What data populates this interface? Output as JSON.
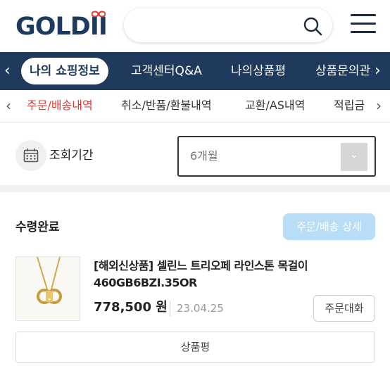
{
  "header": {
    "logo_text": "GOLDII",
    "search_placeholder": "",
    "colors": {
      "logo": "#1f3a5f",
      "logo_bow": "#e53935"
    }
  },
  "nav": {
    "items": [
      {
        "label": "나의 쇼핑정보",
        "active": true
      },
      {
        "label": "고객센터Q&A",
        "active": false
      },
      {
        "label": "나의상품평",
        "active": false
      },
      {
        "label": "상품문의관",
        "active": false
      }
    ],
    "background": "#1f3a5c"
  },
  "subtabs": {
    "items": [
      {
        "label": "주문/배송내역",
        "active": true
      },
      {
        "label": "취소/반품/환불내역",
        "active": false
      },
      {
        "label": "교환/AS내역",
        "active": false
      },
      {
        "label": "적립금",
        "active": false
      }
    ],
    "active_color": "#e53935"
  },
  "period": {
    "label": "조회기간",
    "selected": "6개월"
  },
  "order": {
    "status": "수령완료",
    "detail_button": "주문/배송 상세",
    "product_name": "[해외신상품] 셀린느 트리오페 라인스톤 목걸이 460GB6BZI.35OR",
    "price": "778,500 원",
    "date": "23.04.25",
    "chat_button": "주문대화",
    "review_button": "상품평",
    "accent": "#b9dcf7"
  }
}
